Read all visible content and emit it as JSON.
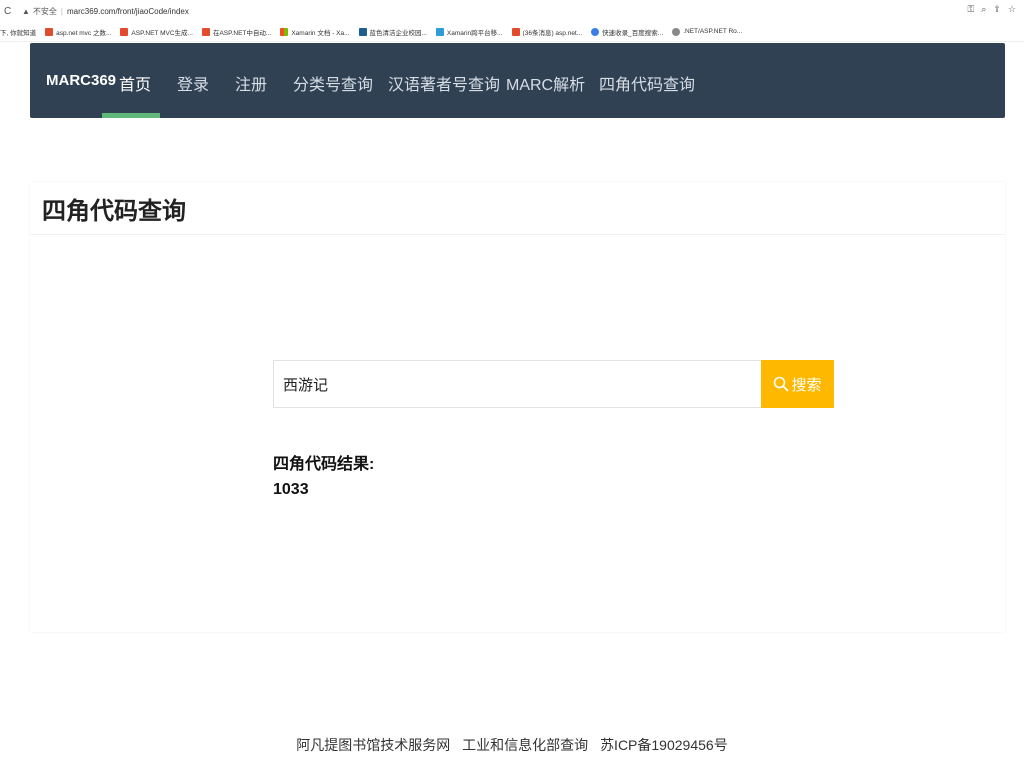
{
  "browser": {
    "security_label": "不安全",
    "url": "marc369.com/front/jiaoCode/index"
  },
  "bookmarks": [
    {
      "label": "下, 你就知道",
      "color": "#ffffff"
    },
    {
      "label": "asp.net mvc 之数...",
      "color": "#e24b2b"
    },
    {
      "label": "ASP.NET MVC生成...",
      "color": "#e24b2b"
    },
    {
      "label": "在ASP.NET中自动...",
      "color": "#e24b2b"
    },
    {
      "label": "Xamarin 文档 - Xa...",
      "color": "#f5a623"
    },
    {
      "label": "蓝色清洁企业校园...",
      "color": "#1f5d8f"
    },
    {
      "label": "Xamarin跨平台移...",
      "color": "#2f9bd7"
    },
    {
      "label": "(36条消息) asp.net...",
      "color": "#e24b2b"
    },
    {
      "label": "快速收录_百度搜索...",
      "color": "#3a7ee6"
    },
    {
      "label": ".NET/ASP.NET Ro...",
      "color": "#888888"
    }
  ],
  "nav": {
    "brand": "MARC369",
    "items": [
      "首页",
      "登录",
      "注册",
      "分类号查询",
      "汉语著者号查询",
      "MARC解析",
      "四角代码查询"
    ]
  },
  "panel": {
    "title": "四角代码查询"
  },
  "search": {
    "value": "西游记",
    "button_label": "搜索"
  },
  "result": {
    "label": "四角代码结果:",
    "value": "1033"
  },
  "footer": {
    "links": [
      "阿凡提图书馆技术服务网",
      "工业和信息化部查询",
      "苏ICP备19029456号"
    ]
  }
}
